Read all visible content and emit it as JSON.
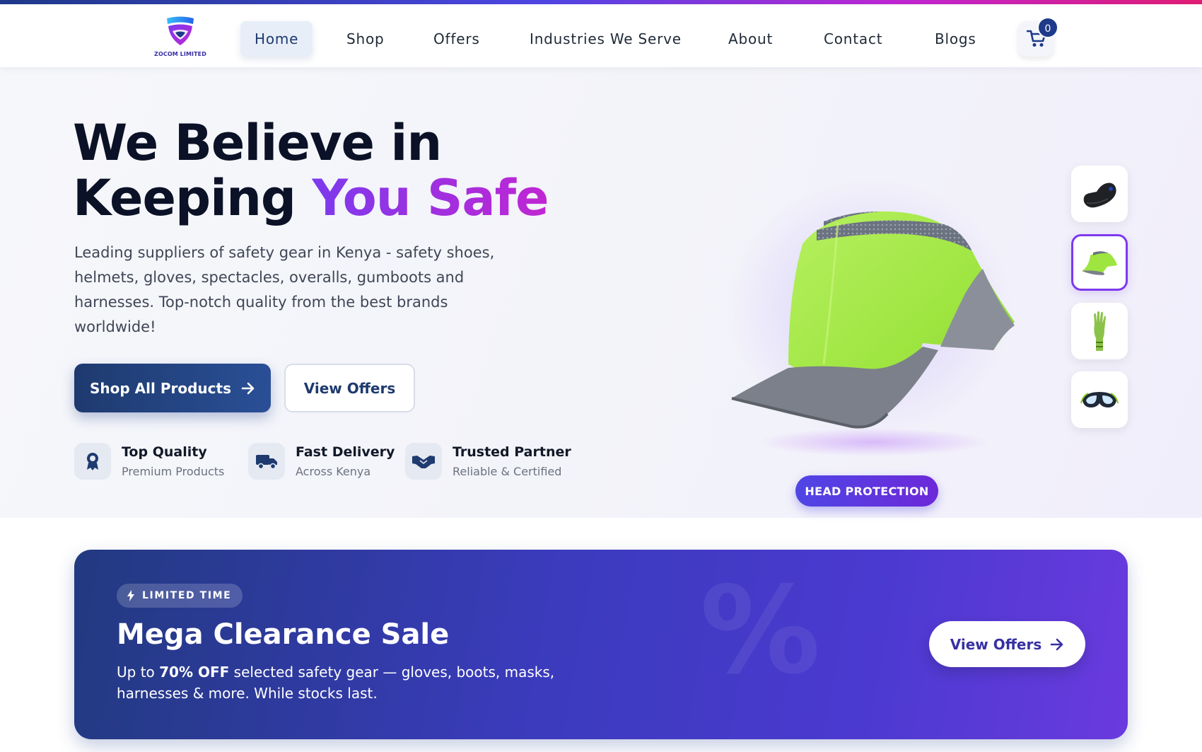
{
  "brand": {
    "name": "ZOCOM LIMITED"
  },
  "nav": {
    "items": [
      {
        "label": "Home",
        "active": true
      },
      {
        "label": "Shop"
      },
      {
        "label": "Offers"
      },
      {
        "label": "Industries We Serve"
      },
      {
        "label": "About"
      },
      {
        "label": "Contact"
      },
      {
        "label": "Blogs"
      }
    ],
    "cart_count": "0"
  },
  "hero": {
    "title_line1": "We Believe in",
    "title_line2_prefix": "Keeping ",
    "title_line2_accent": "You Safe",
    "description": "Leading suppliers of safety gear in Kenya - safety shoes, helmets, gloves, spectacles, overalls, gumboots and harnesses. Top-notch quality from the best brands worldwide!",
    "primary_button": "Shop All Products",
    "secondary_button": "View Offers",
    "features": [
      {
        "title": "Top Quality",
        "subtitle": "Premium Products",
        "icon": "award-icon"
      },
      {
        "title": "Fast Delivery",
        "subtitle": "Across Kenya",
        "icon": "truck-icon"
      },
      {
        "title": "Trusted Partner",
        "subtitle": "Reliable & Certified",
        "icon": "handshake-icon"
      }
    ],
    "product_badge": "HEAD PROTECTION",
    "thumbnails": [
      {
        "icon": "safety-shoe-icon"
      },
      {
        "icon": "bump-cap-icon",
        "active": true
      },
      {
        "icon": "glove-icon"
      },
      {
        "icon": "goggles-icon"
      }
    ]
  },
  "promo": {
    "pill": "LIMITED TIME",
    "title": "Mega Clearance Sale",
    "desc_prefix": "Up to ",
    "desc_bold": "70% OFF",
    "desc_suffix": " selected safety gear — gloves, boots, masks, harnesses & more. While stocks last.",
    "button": "View Offers",
    "background_glyph": "%"
  },
  "colors": {
    "primary": "#1e3a6f",
    "accent": "#7c3aed",
    "promo_start": "#223a80",
    "promo_end": "#6a3ade",
    "bump_cap_green": "#9ee540"
  }
}
